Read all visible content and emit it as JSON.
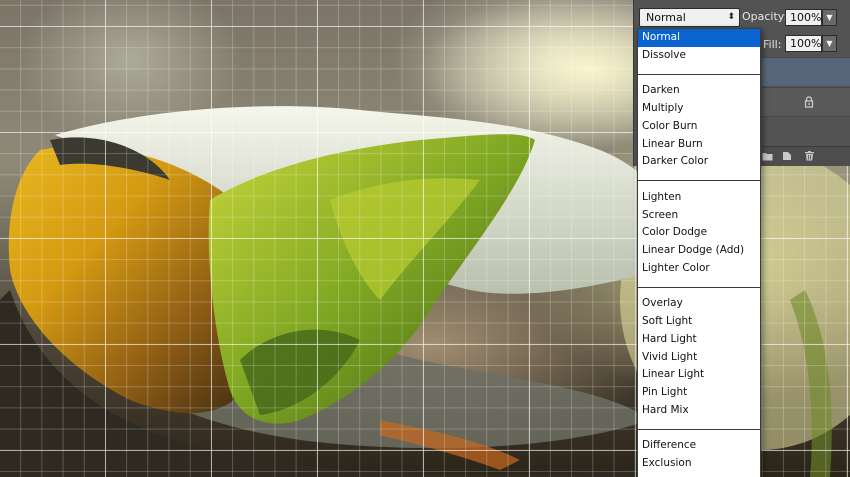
{
  "blend_mode": {
    "current": "Normal",
    "groups": [
      [
        "Normal",
        "Dissolve"
      ],
      [
        "Darken",
        "Multiply",
        "Color Burn",
        "Linear Burn",
        "Darker Color"
      ],
      [
        "Lighten",
        "Screen",
        "Color Dodge",
        "Linear Dodge (Add)",
        "Lighter Color"
      ],
      [
        "Overlay",
        "Soft Light",
        "Hard Light",
        "Vivid Light",
        "Linear Light",
        "Pin Light",
        "Hard Mix"
      ],
      [
        "Difference",
        "Exclusion"
      ]
    ],
    "selected_index": 0
  },
  "layers_panel": {
    "opacity_label": "Opacity:",
    "opacity_value": "100%",
    "fill_label": "Fill:",
    "fill_value": "100%",
    "icons": [
      "lock-icon",
      "folder-icon",
      "new-layer-icon",
      "trash-icon"
    ]
  },
  "canvas": {
    "grid_visible": true
  },
  "colors": {
    "selection_highlight": "#0a64cf",
    "panel_background": "#535353",
    "selected_layer": "#59667a"
  }
}
